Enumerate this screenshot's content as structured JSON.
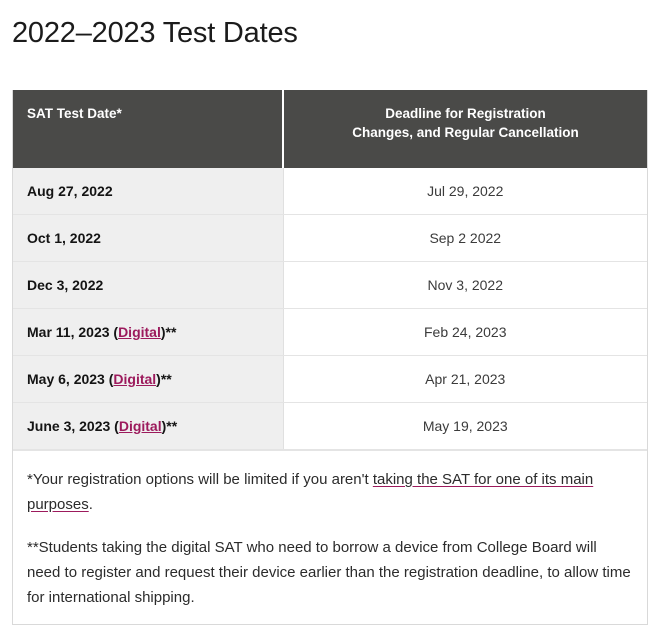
{
  "page": {
    "title": "2022–2023 Test Dates"
  },
  "table": {
    "headers": {
      "col1": "SAT Test Date*",
      "col2_line1": "Deadline for Registration",
      "col2_line2": "Changes, and Regular Cancellation"
    },
    "rows": [
      {
        "date_prefix": "Aug 27, 2022",
        "link_label": "",
        "date_suffix": "",
        "deadline": "Jul 29, 2022"
      },
      {
        "date_prefix": "Oct 1, 2022",
        "link_label": "",
        "date_suffix": "",
        "deadline": "Sep 2 2022"
      },
      {
        "date_prefix": "Dec 3, 2022",
        "link_label": "",
        "date_suffix": "",
        "deadline": "Nov 3, 2022"
      },
      {
        "date_prefix": "Mar 11, 2023 (",
        "link_label": "Digital",
        "date_suffix": ")**",
        "deadline": "Feb 24, 2023"
      },
      {
        "date_prefix": "May 6, 2023 (",
        "link_label": "Digital",
        "date_suffix": ")**",
        "deadline": "Apr 21, 2023"
      },
      {
        "date_prefix": "June 3, 2023 (",
        "link_label": "Digital",
        "date_suffix": ")**",
        "deadline": "May 19, 2023"
      }
    ]
  },
  "footnotes": {
    "note1_before": "*Your registration options will be limited if you aren't ",
    "note1_link": "taking the SAT for one of its main purposes",
    "note1_after": ".",
    "note2": "**Students taking the digital SAT who need to borrow a device from College Board will need to register and request their device earlier than the registration deadline, to allow time for international shipping."
  },
  "colors": {
    "header_background": "#4a4a48",
    "link_accent": "#9c1a5c",
    "row_alt_background": "#efefef",
    "border": "#e4e4e4",
    "text": "#1a1a1a"
  }
}
